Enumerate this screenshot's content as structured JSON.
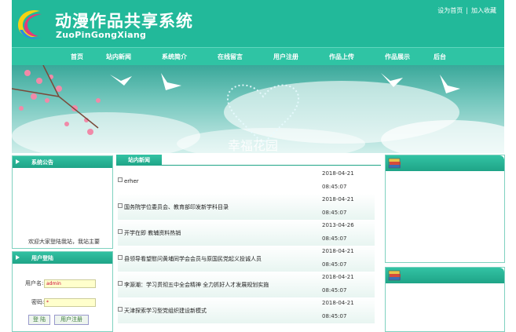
{
  "header": {
    "title_cn": "动漫作品共享系统",
    "title_en": "ZuoPinGongXiang",
    "links": [
      "设为首页",
      "加入收藏"
    ],
    "link_separator": "|"
  },
  "nav": {
    "items": [
      "首页",
      "站内新闻",
      "系统简介",
      "在线留言",
      "用户注册",
      "作品上传",
      "作品展示",
      "后台"
    ]
  },
  "banner": {
    "text": "幸福花园"
  },
  "notice": {
    "title": "系统公告",
    "text": "欢迎大家登陆我站，我站主要"
  },
  "login": {
    "title": "用户登陆",
    "username_label": "用户名:",
    "username_value": "admin",
    "password_label": "密码:",
    "password_value": "*",
    "login_button": "登 陆",
    "register_button": "用户注册"
  },
  "news": {
    "tab": "站内新闻",
    "items": [
      {
        "title": "erher",
        "date": "2018-04-21",
        "time": "08:45:07"
      },
      {
        "title": "国务院学位委员会、教育部印发新学科目录",
        "date": "2018-04-21",
        "time": "08:45:07"
      },
      {
        "title": "开学在即 教辅资料热销",
        "date": "2013-04-26",
        "time": "08:45:07"
      },
      {
        "title": "县领导看望慰问黄埔同学会会员与原国民党起义投诚人员",
        "date": "2018-04-21",
        "time": "08:45:07"
      },
      {
        "title": "李源潮：学习贯彻五中全会精神 全力抓好人才发展规划实施",
        "date": "2018-04-21",
        "time": "08:45:07"
      },
      {
        "title": "天津探索学习型党组织建设新模式",
        "date": "2018-04-21",
        "time": "08:45:07"
      }
    ]
  },
  "colors": {
    "primary": "#22b99a",
    "nav": "#2fc4a4",
    "row_band": "#e8f5f1",
    "border": "#7fd2c0"
  }
}
